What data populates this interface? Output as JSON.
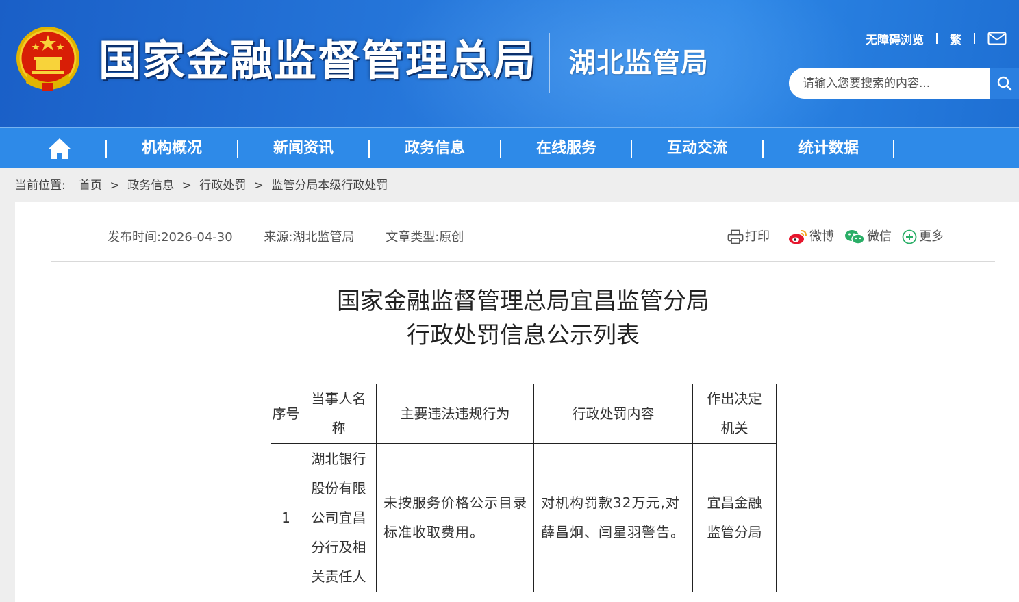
{
  "header": {
    "site_title": "国家金融监督管理总局",
    "sub_title": "湖北监管局",
    "top_links": {
      "accessible": "无障碍浏览",
      "traditional": "繁",
      "mail_icon": "mail-icon"
    },
    "search": {
      "placeholder": "请输入您要搜索的内容...",
      "button_icon": "search-icon"
    }
  },
  "nav": {
    "home_icon": "home-icon",
    "items": [
      "机构概况",
      "新闻资讯",
      "政务信息",
      "在线服务",
      "互动交流",
      "统计数据"
    ]
  },
  "breadcrumb": {
    "label": "当前位置:",
    "items": [
      "首页",
      "政务信息",
      "行政处罚",
      "监管分局本级行政处罚"
    ],
    "separator": ">"
  },
  "article": {
    "meta": {
      "publish": "发布时间:2026-04-30",
      "source": "来源:湖北监管局",
      "type": "文章类型:原创"
    },
    "share": {
      "print": "打印",
      "weibo": "微博",
      "wechat": "微信",
      "more": "更多"
    },
    "title_line1": "国家金融监督管理总局宜昌监管分局",
    "title_line2": "行政处罚信息公示列表"
  },
  "table": {
    "headers": [
      "序号",
      "当事人名称",
      "主要违法违规行为",
      "行政处罚内容",
      "作出决定机关"
    ],
    "rows": [
      {
        "no": "1",
        "party": "湖北银行股份有限公司宜昌分行及相关责任人",
        "violation": "未按服务价格公示目录标准收取费用。",
        "penalty": "对机构罚款32万元,对薛昌炯、闫星羽警告。",
        "authority": "宜昌金融监管分局"
      }
    ]
  },
  "colors": {
    "header_blue": "#2779dc",
    "nav_blue": "#2e8ae8",
    "background": "#eeeeee"
  }
}
